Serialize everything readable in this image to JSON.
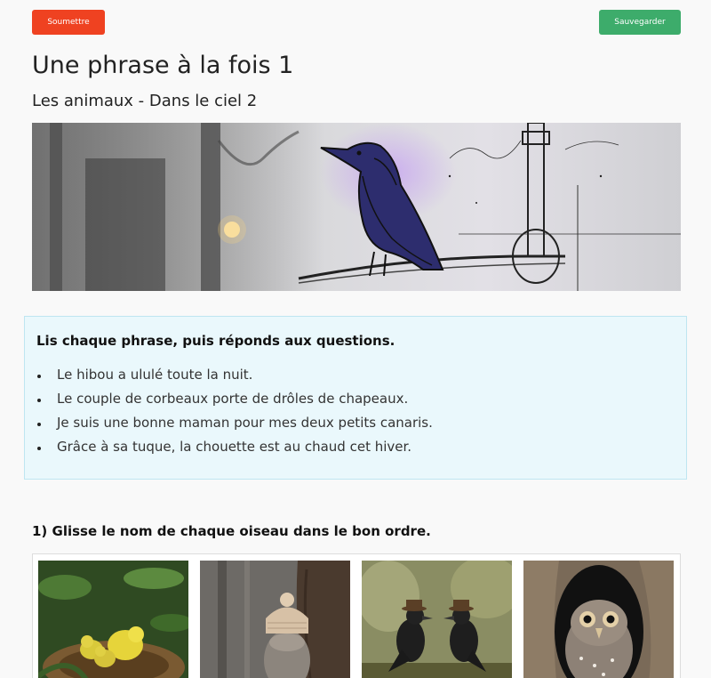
{
  "toolbar": {
    "submit_label": "Soumettre",
    "save_label": "Sauvegarder",
    "submit_color": "#ef4221",
    "save_color": "#3dac6b"
  },
  "header": {
    "title": "Une phrase à la fois 1",
    "subtitle": "Les animaux - Dans le ciel 2"
  },
  "banner": {
    "icon": "crow-sketch-illustration"
  },
  "instructions": {
    "heading": "Lis chaque phrase, puis réponds aux questions.",
    "sentences": [
      "Le hibou a ululé toute la nuit.",
      "Le couple de corbeaux porte de drôles de chapeaux.",
      "Je suis une bonne maman pour mes deux petits canaris.",
      "Grâce à sa tuque, la chouette est au chaud cet hiver."
    ]
  },
  "question1": {
    "label": "1) Glisse le nom de chaque oiseau dans le bon ordre.",
    "images": [
      {
        "icon": "canaries-nest-image"
      },
      {
        "icon": "owl-with-tuque-image"
      },
      {
        "icon": "crows-with-hats-image"
      },
      {
        "icon": "owl-in-tree-image"
      }
    ]
  }
}
